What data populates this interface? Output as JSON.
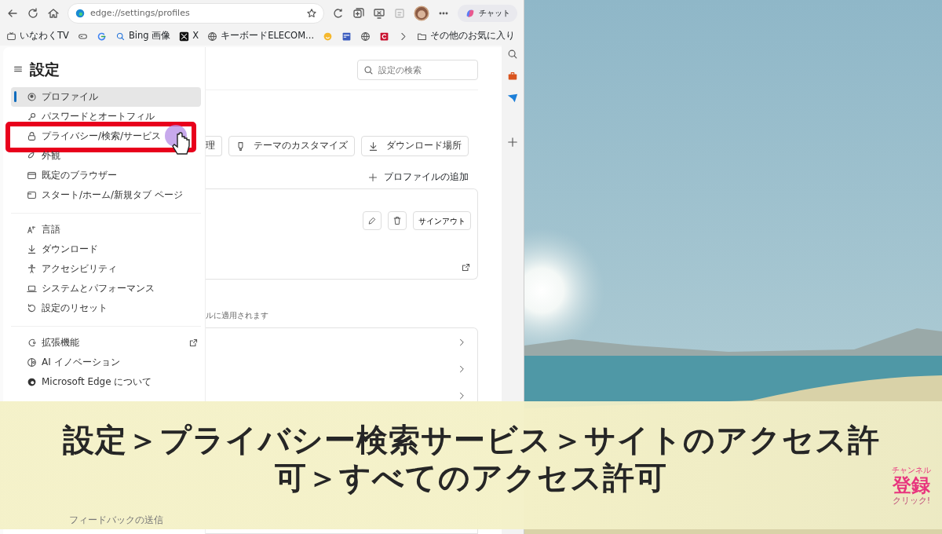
{
  "browser": {
    "address": "edge://settings/profiles",
    "copilot_label": "チャット",
    "favorites": [
      {
        "kind": "site",
        "label": "いなわくTV"
      },
      {
        "kind": "icon"
      },
      {
        "kind": "icon"
      },
      {
        "kind": "site",
        "label": "Bing 画像"
      },
      {
        "kind": "site",
        "label": "X"
      },
      {
        "kind": "site",
        "label": "キーボードELECOM..."
      },
      {
        "kind": "icon"
      },
      {
        "kind": "icon"
      },
      {
        "kind": "icon"
      },
      {
        "kind": "icon"
      },
      {
        "kind": "more"
      },
      {
        "kind": "folder",
        "label": "その他のお気に入り"
      }
    ]
  },
  "settings": {
    "title": "設定",
    "search_placeholder": "設定の検索",
    "nav_groups": [
      [
        {
          "label": "プロファイル",
          "selected": true,
          "highlighted": false,
          "external": false
        },
        {
          "label": "パスワードとオートフィル",
          "selected": false,
          "highlighted": false,
          "external": false
        },
        {
          "label": "プライバシー/検索/サービス",
          "selected": false,
          "highlighted": true,
          "external": false
        },
        {
          "label": "外観",
          "selected": false,
          "highlighted": false,
          "external": false
        },
        {
          "label": "既定のブラウザー",
          "selected": false,
          "highlighted": false,
          "external": false
        },
        {
          "label": "スタート/ホーム/新規タブ ページ",
          "selected": false,
          "highlighted": false,
          "external": false
        }
      ],
      [
        {
          "label": "言語",
          "selected": false,
          "highlighted": false,
          "external": false
        },
        {
          "label": "ダウンロード",
          "selected": false,
          "highlighted": false,
          "external": false
        },
        {
          "label": "アクセシビリティ",
          "selected": false,
          "highlighted": false,
          "external": false
        },
        {
          "label": "システムとパフォーマンス",
          "selected": false,
          "highlighted": false,
          "external": false
        },
        {
          "label": "設定のリセット",
          "selected": false,
          "highlighted": false,
          "external": false
        }
      ],
      [
        {
          "label": "拡張機能",
          "selected": false,
          "highlighted": false,
          "external": true
        },
        {
          "label": "AI イノベーション",
          "selected": false,
          "highlighted": false,
          "external": false
        },
        {
          "label": "Microsoft Edge について",
          "selected": false,
          "highlighted": false,
          "external": false
        }
      ]
    ],
    "feedback": "フィードバックの送信",
    "action_buttons": [
      {
        "label": "理"
      },
      {
        "label": "テーマのカスタマイズ"
      },
      {
        "label": "ダウンロード場所"
      }
    ],
    "add_profile": "プロファイルの追加",
    "sign_out": "サインアウト",
    "note": "ルに適用されます"
  },
  "caption": {
    "lines": [
      "設定＞プライバシー検索サービス＞サイトのアクセス許",
      "可＞すべてのアクセス許可"
    ]
  },
  "subscribe_badge": {
    "top": "チャンネル",
    "main": "登録",
    "bottom": "クリック!"
  }
}
